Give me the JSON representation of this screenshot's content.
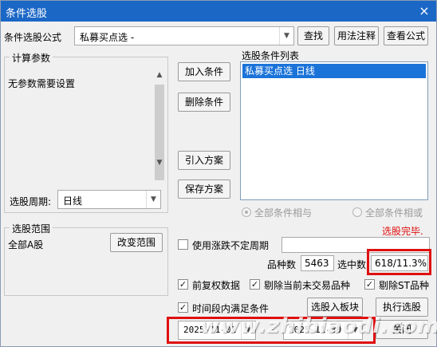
{
  "window": {
    "title": "条件选股",
    "close_glyph": "×"
  },
  "formula": {
    "label": "条件选股公式",
    "value": "私募买点选  -",
    "search_button": "查找",
    "usage_button": "用法注释",
    "view_button": "查看公式"
  },
  "params": {
    "group_title": "计算参数",
    "text": "无参数需要设置"
  },
  "period": {
    "label": "选股周期:",
    "value": "日线"
  },
  "actions": {
    "add": "加入条件",
    "delete": "删除条件",
    "import": "引入方案",
    "save": "保存方案"
  },
  "condition_list": {
    "title": "选股条件列表",
    "items": [
      "私募买点选  日线"
    ]
  },
  "logic": {
    "and_label": "全部条件相与",
    "or_label": "全部条件相或"
  },
  "status": {
    "text": "选股完毕.",
    "color": "#e01010"
  },
  "scope": {
    "group_title": "选股范围",
    "value": "全部A股",
    "change_button": "改变范围"
  },
  "irregular_period": {
    "label": "使用涨跌不定周期",
    "value": ""
  },
  "stats": {
    "count_label": "品种数",
    "count_value": "5463",
    "selected_label": "选中数",
    "selected_value": "618/11.3%"
  },
  "options": {
    "adjusted": "前复权数据",
    "exclude_untraded": "剔除当前未交易品种",
    "exclude_st": "剔除ST品种",
    "time_range": "时间段内满足条件"
  },
  "buttons": {
    "to_block": "选股入板块",
    "execute": "执行选股",
    "close": "关闭"
  },
  "dates": {
    "start": "2025-11-01",
    "separator": "-",
    "end": "2025-11-30"
  },
  "watermark": "www.zhibiaodi.com"
}
